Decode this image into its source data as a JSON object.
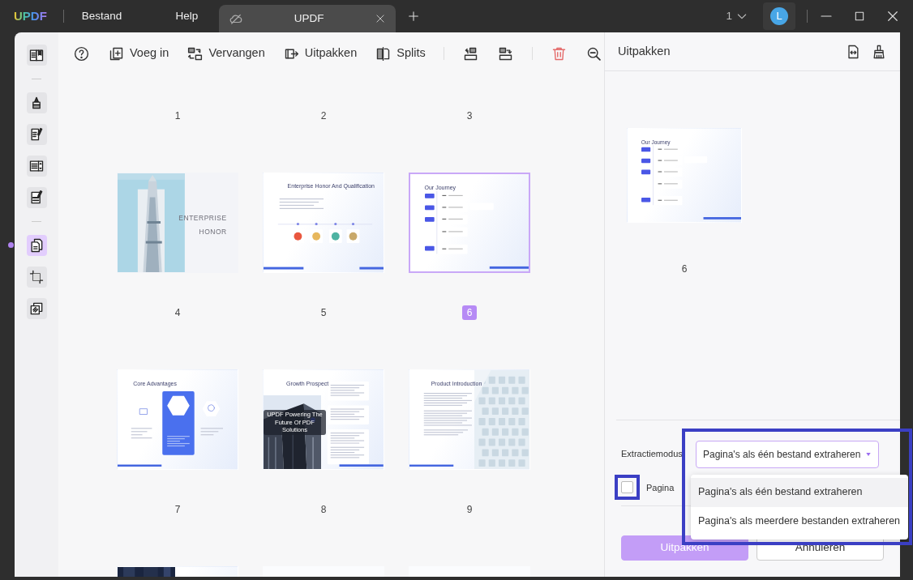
{
  "app": {
    "logo": "UPDF",
    "menu": [
      {
        "label": "Bestand"
      },
      {
        "label": "Help"
      }
    ]
  },
  "tabs": [
    {
      "label": "UPDF",
      "selected": true
    }
  ],
  "title_bar": {
    "page_count": "1",
    "avatar": "L"
  },
  "sidebar": {
    "items": [
      {
        "kind": "reader",
        "selected": false
      },
      {
        "kind": "divider"
      },
      {
        "kind": "highlight",
        "selected": false
      },
      {
        "kind": "edit",
        "selected": false
      },
      {
        "kind": "form",
        "selected": false
      },
      {
        "kind": "redact",
        "selected": false
      },
      {
        "kind": "divider"
      },
      {
        "kind": "organize",
        "selected": true
      },
      {
        "kind": "crop",
        "selected": false
      },
      {
        "kind": "layers",
        "selected": false
      }
    ]
  },
  "toolbar": {
    "items": [
      {
        "kind": "help"
      },
      {
        "kind": "insert",
        "label": "Voeg in"
      },
      {
        "kind": "replace",
        "label": "Vervangen"
      },
      {
        "kind": "extract",
        "label": "Uitpakken"
      },
      {
        "kind": "split",
        "label": "Splits"
      },
      {
        "kind": "separator"
      },
      {
        "kind": "rotate_left"
      },
      {
        "kind": "rotate_right"
      },
      {
        "kind": "separator"
      },
      {
        "kind": "delete"
      },
      {
        "kind": "zoom_out"
      }
    ]
  },
  "pages": {
    "numbers_above": [
      "1",
      "2",
      "3"
    ],
    "thumbnails": [
      {
        "number": "4",
        "selected": false,
        "kind": "cover",
        "title_lines": [
          "ENTERPRISE",
          "HONOR"
        ]
      },
      {
        "number": "5",
        "selected": false,
        "kind": "honors",
        "title": "Enterprise Honor And Qualification"
      },
      {
        "number": "6",
        "selected": true,
        "kind": "timeline",
        "title": "Our Journey"
      },
      {
        "number": "7",
        "selected": false,
        "kind": "advantages",
        "title": "Core Advantages"
      },
      {
        "number": "8",
        "selected": false,
        "kind": "growth",
        "title": "Growth Prospect",
        "caption": "UPDF Powering The Future Of PDF Solutions"
      },
      {
        "number": "9",
        "selected": false,
        "kind": "product",
        "title": "Product Introduction"
      }
    ],
    "next_row": [
      {
        "kind": "dark_left"
      },
      {
        "kind": "plain"
      },
      {
        "kind": "plain"
      }
    ]
  },
  "panel": {
    "title": "Uitpakken",
    "preview": {
      "number": "6",
      "kind": "timeline",
      "title": "Our Journey"
    },
    "mode_label": "Extractiemodus",
    "mode": {
      "value": "Pagina's als één bestand extraheren",
      "expanded": true,
      "highlighted": true,
      "options": [
        {
          "label": "Pagina's als één bestand extraheren",
          "selected": true
        },
        {
          "label": "Pagina's als meerdere bestanden extraheren",
          "selected": false
        }
      ]
    },
    "option_checkbox": {
      "label": "Pagina",
      "checked": false,
      "highlighted": true
    },
    "buttons": [
      {
        "kind": "primary",
        "label": "Uitpakken"
      },
      {
        "kind": "secondary",
        "label": "Annuleren"
      }
    ]
  }
}
